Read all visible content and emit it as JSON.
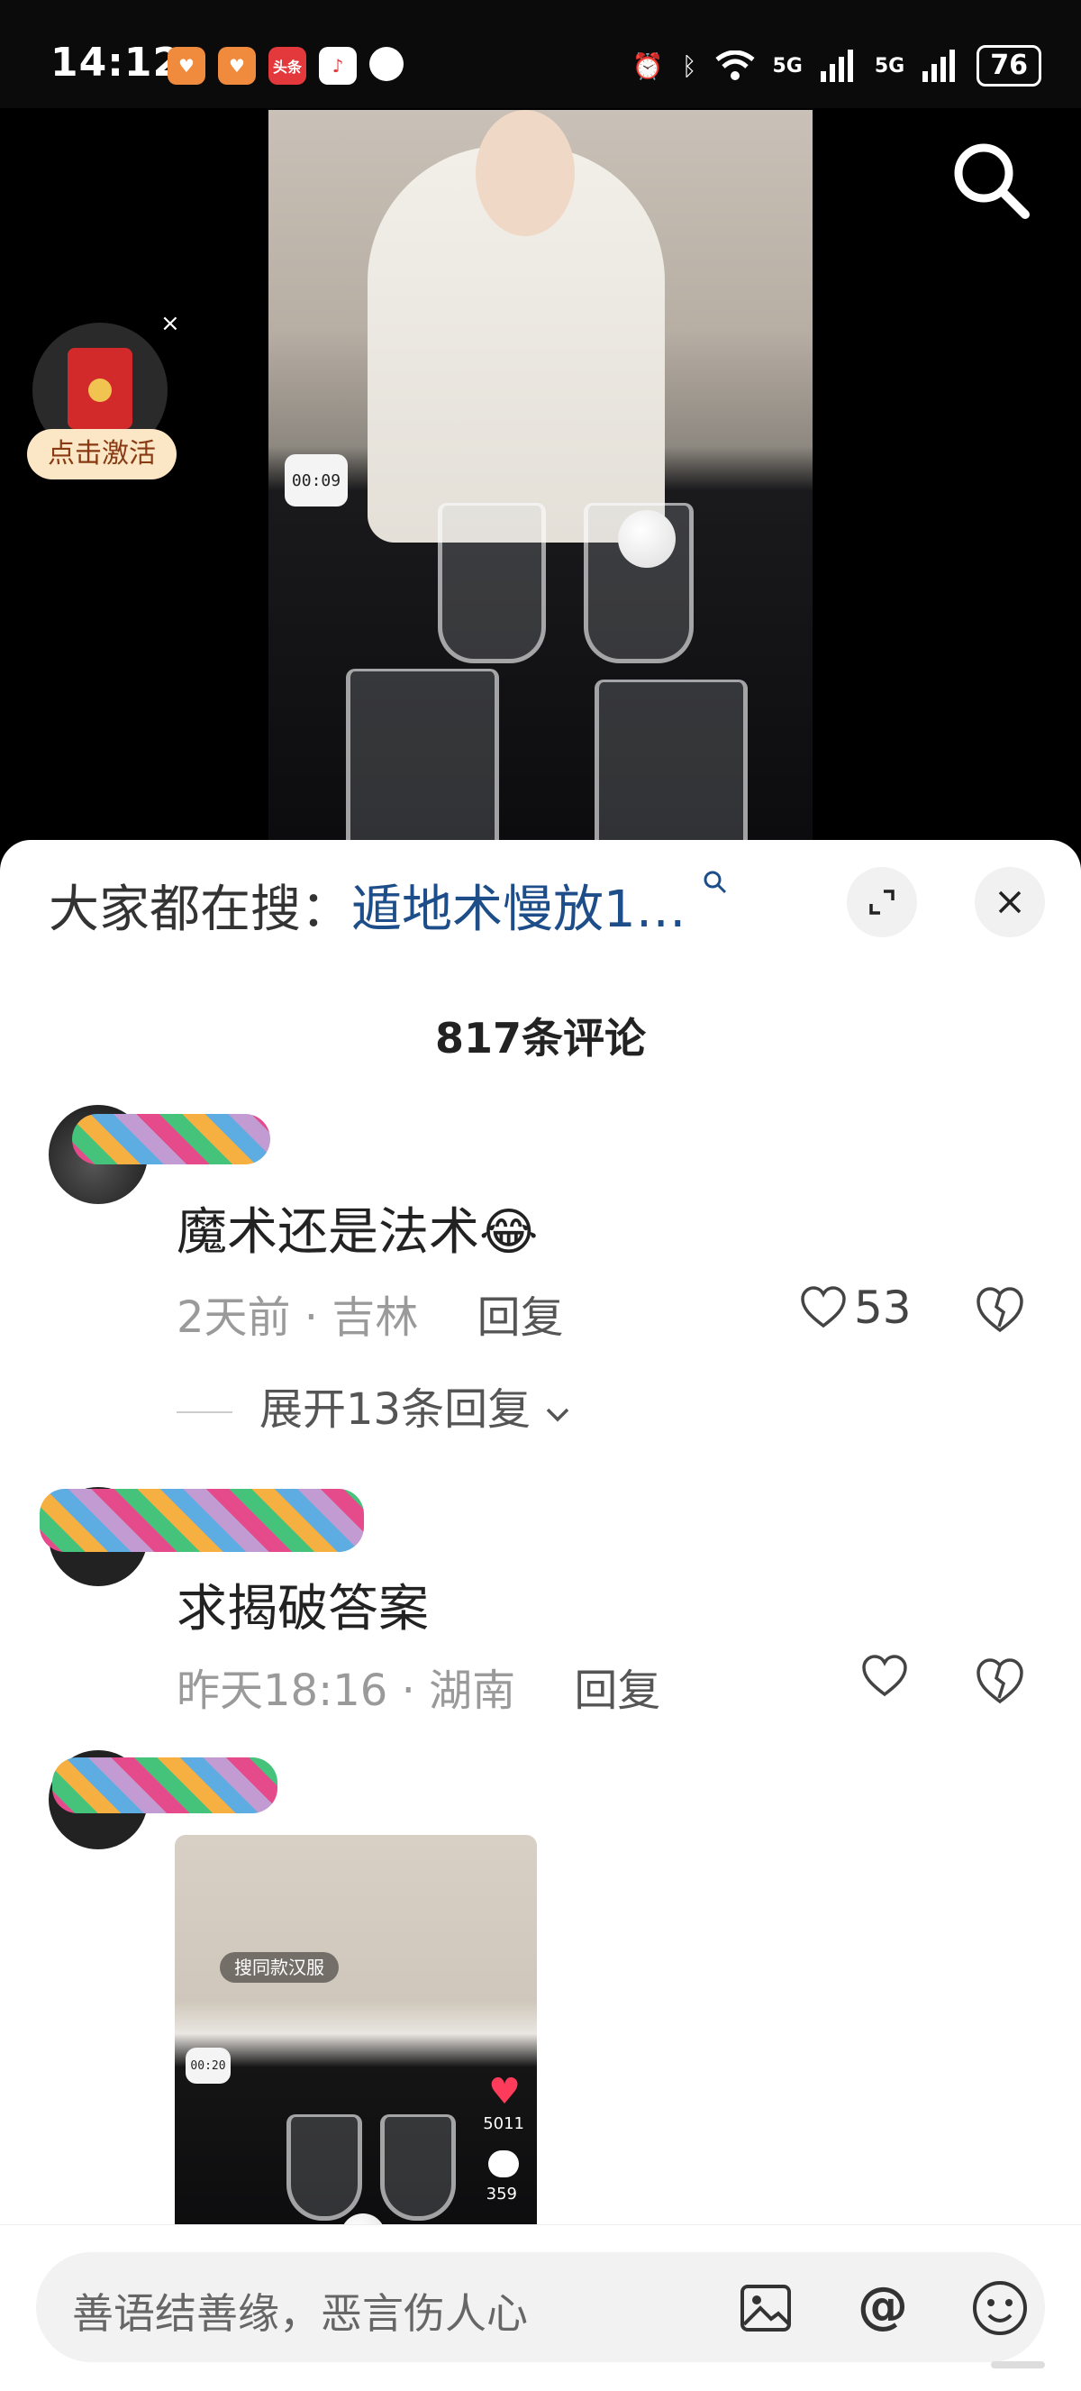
{
  "status_bar": {
    "time": "14:12",
    "apps": [
      {
        "icon": "app-heart-icon",
        "label": "♥",
        "color": "#f08a3c"
      },
      {
        "icon": "app-heart-icon",
        "label": "♥",
        "color": "#f08a3c"
      },
      {
        "icon": "toutiao-icon",
        "label": "头条",
        "color": "#e4393c"
      },
      {
        "icon": "music-icon",
        "label": "♪",
        "color": "#ffffff"
      },
      {
        "icon": "apple-icon",
        "label": "",
        "color": "#ffffff"
      }
    ],
    "signal_1": "5G",
    "signal_2": "5G",
    "battery": "76"
  },
  "red_packet": {
    "label": "点击激活",
    "close": "×"
  },
  "video": {
    "timer": "00:09"
  },
  "sheet": {
    "search_prefix": "大家都在搜：",
    "search_term": "遁地术慢放1…",
    "comment_count": "817条评论"
  },
  "comments": [
    {
      "text": "魔术还是法术",
      "emoji": "😂",
      "time": "2天前",
      "location": "吉林",
      "reply": "回复",
      "likes": "53",
      "expand": "展开13条回复"
    },
    {
      "text": "求揭破答案",
      "time": "昨天18:16",
      "location": "湖南",
      "reply": "回复",
      "likes": ""
    }
  ],
  "thumbnail": {
    "tag": "搜同款汉服",
    "timer": "00:20",
    "likes": "5011",
    "comments": "359"
  },
  "input": {
    "placeholder": "善语结善缘，恶言伤人心"
  },
  "icons": [
    "search-icon",
    "expand-icon",
    "close-icon",
    "heart-icon",
    "dislike-icon",
    "image-icon",
    "at-icon",
    "emoji-icon",
    "chevron-down-icon"
  ]
}
